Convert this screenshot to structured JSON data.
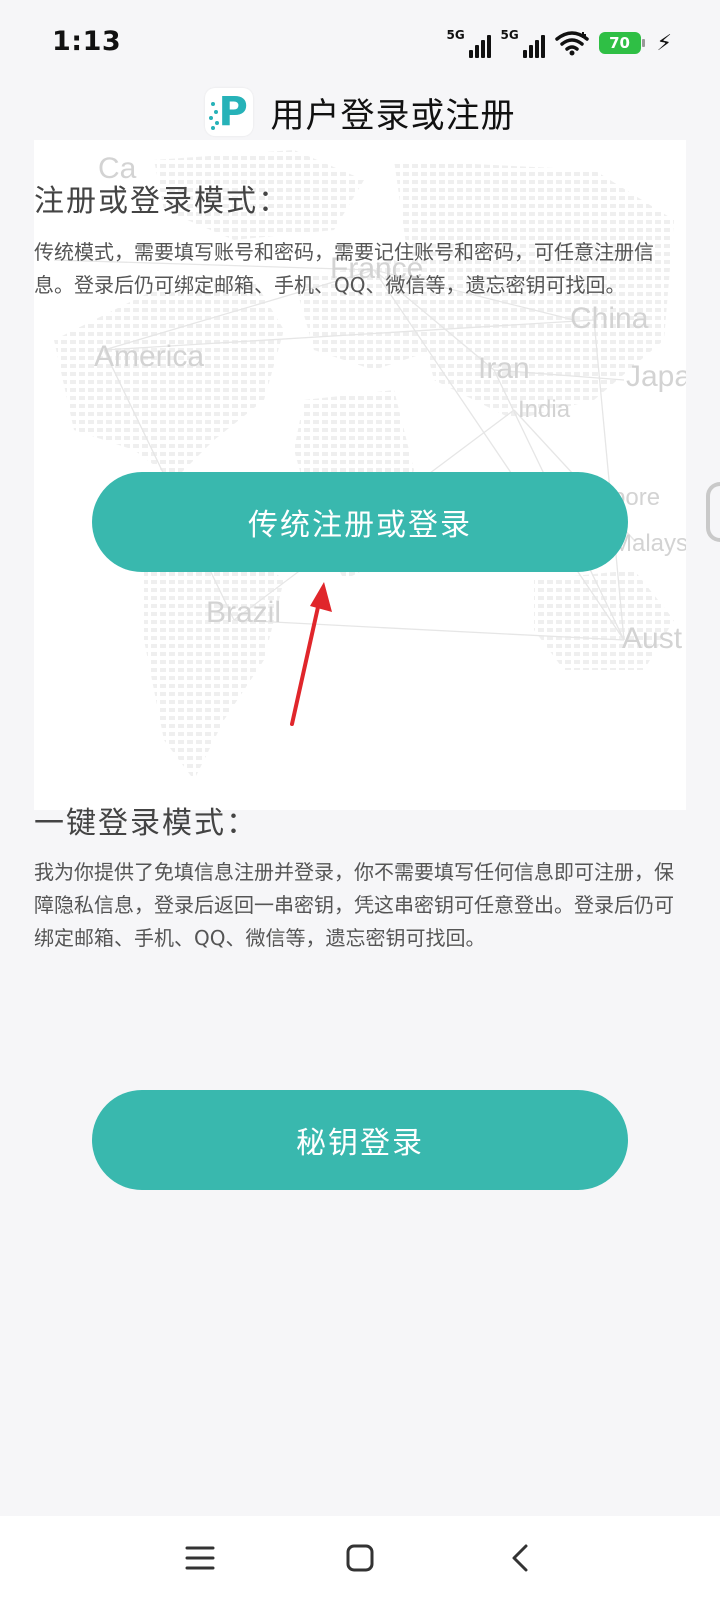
{
  "status_bar": {
    "time": "1:13",
    "network_1": "5G",
    "network_2": "5G",
    "battery": "70"
  },
  "header": {
    "logo_letter": "P",
    "title": "用户登录或注册"
  },
  "map": {
    "labels": [
      "America",
      "France",
      "China",
      "Japa",
      "Iran",
      "India",
      "pore",
      "Malaysia",
      "Brazil",
      "Aust",
      "Ca"
    ]
  },
  "traditional": {
    "title": "注册或登录模式：",
    "description": "传统模式，需要填写账号和密码，需要记住账号和密码，可任意注册信息。登录后仍可绑定邮箱、手机、QQ、微信等，遗忘密钥可找回。",
    "button_label": "传统注册或登录"
  },
  "one_click": {
    "title": "一键登录模式：",
    "description": "我为你提供了免填信息注册并登录，你不需要填写任何信息即可注册，保障隐私信息，登录后返回一串密钥，凭这串密钥可任意登出。登录后仍可绑定邮箱、手机、QQ、微信等，遗忘密钥可找回。",
    "button_label": "秘钥登录"
  },
  "colors": {
    "accent": "#39b8ae",
    "annotation_arrow": "#e0262b",
    "battery": "#2fbf45"
  }
}
